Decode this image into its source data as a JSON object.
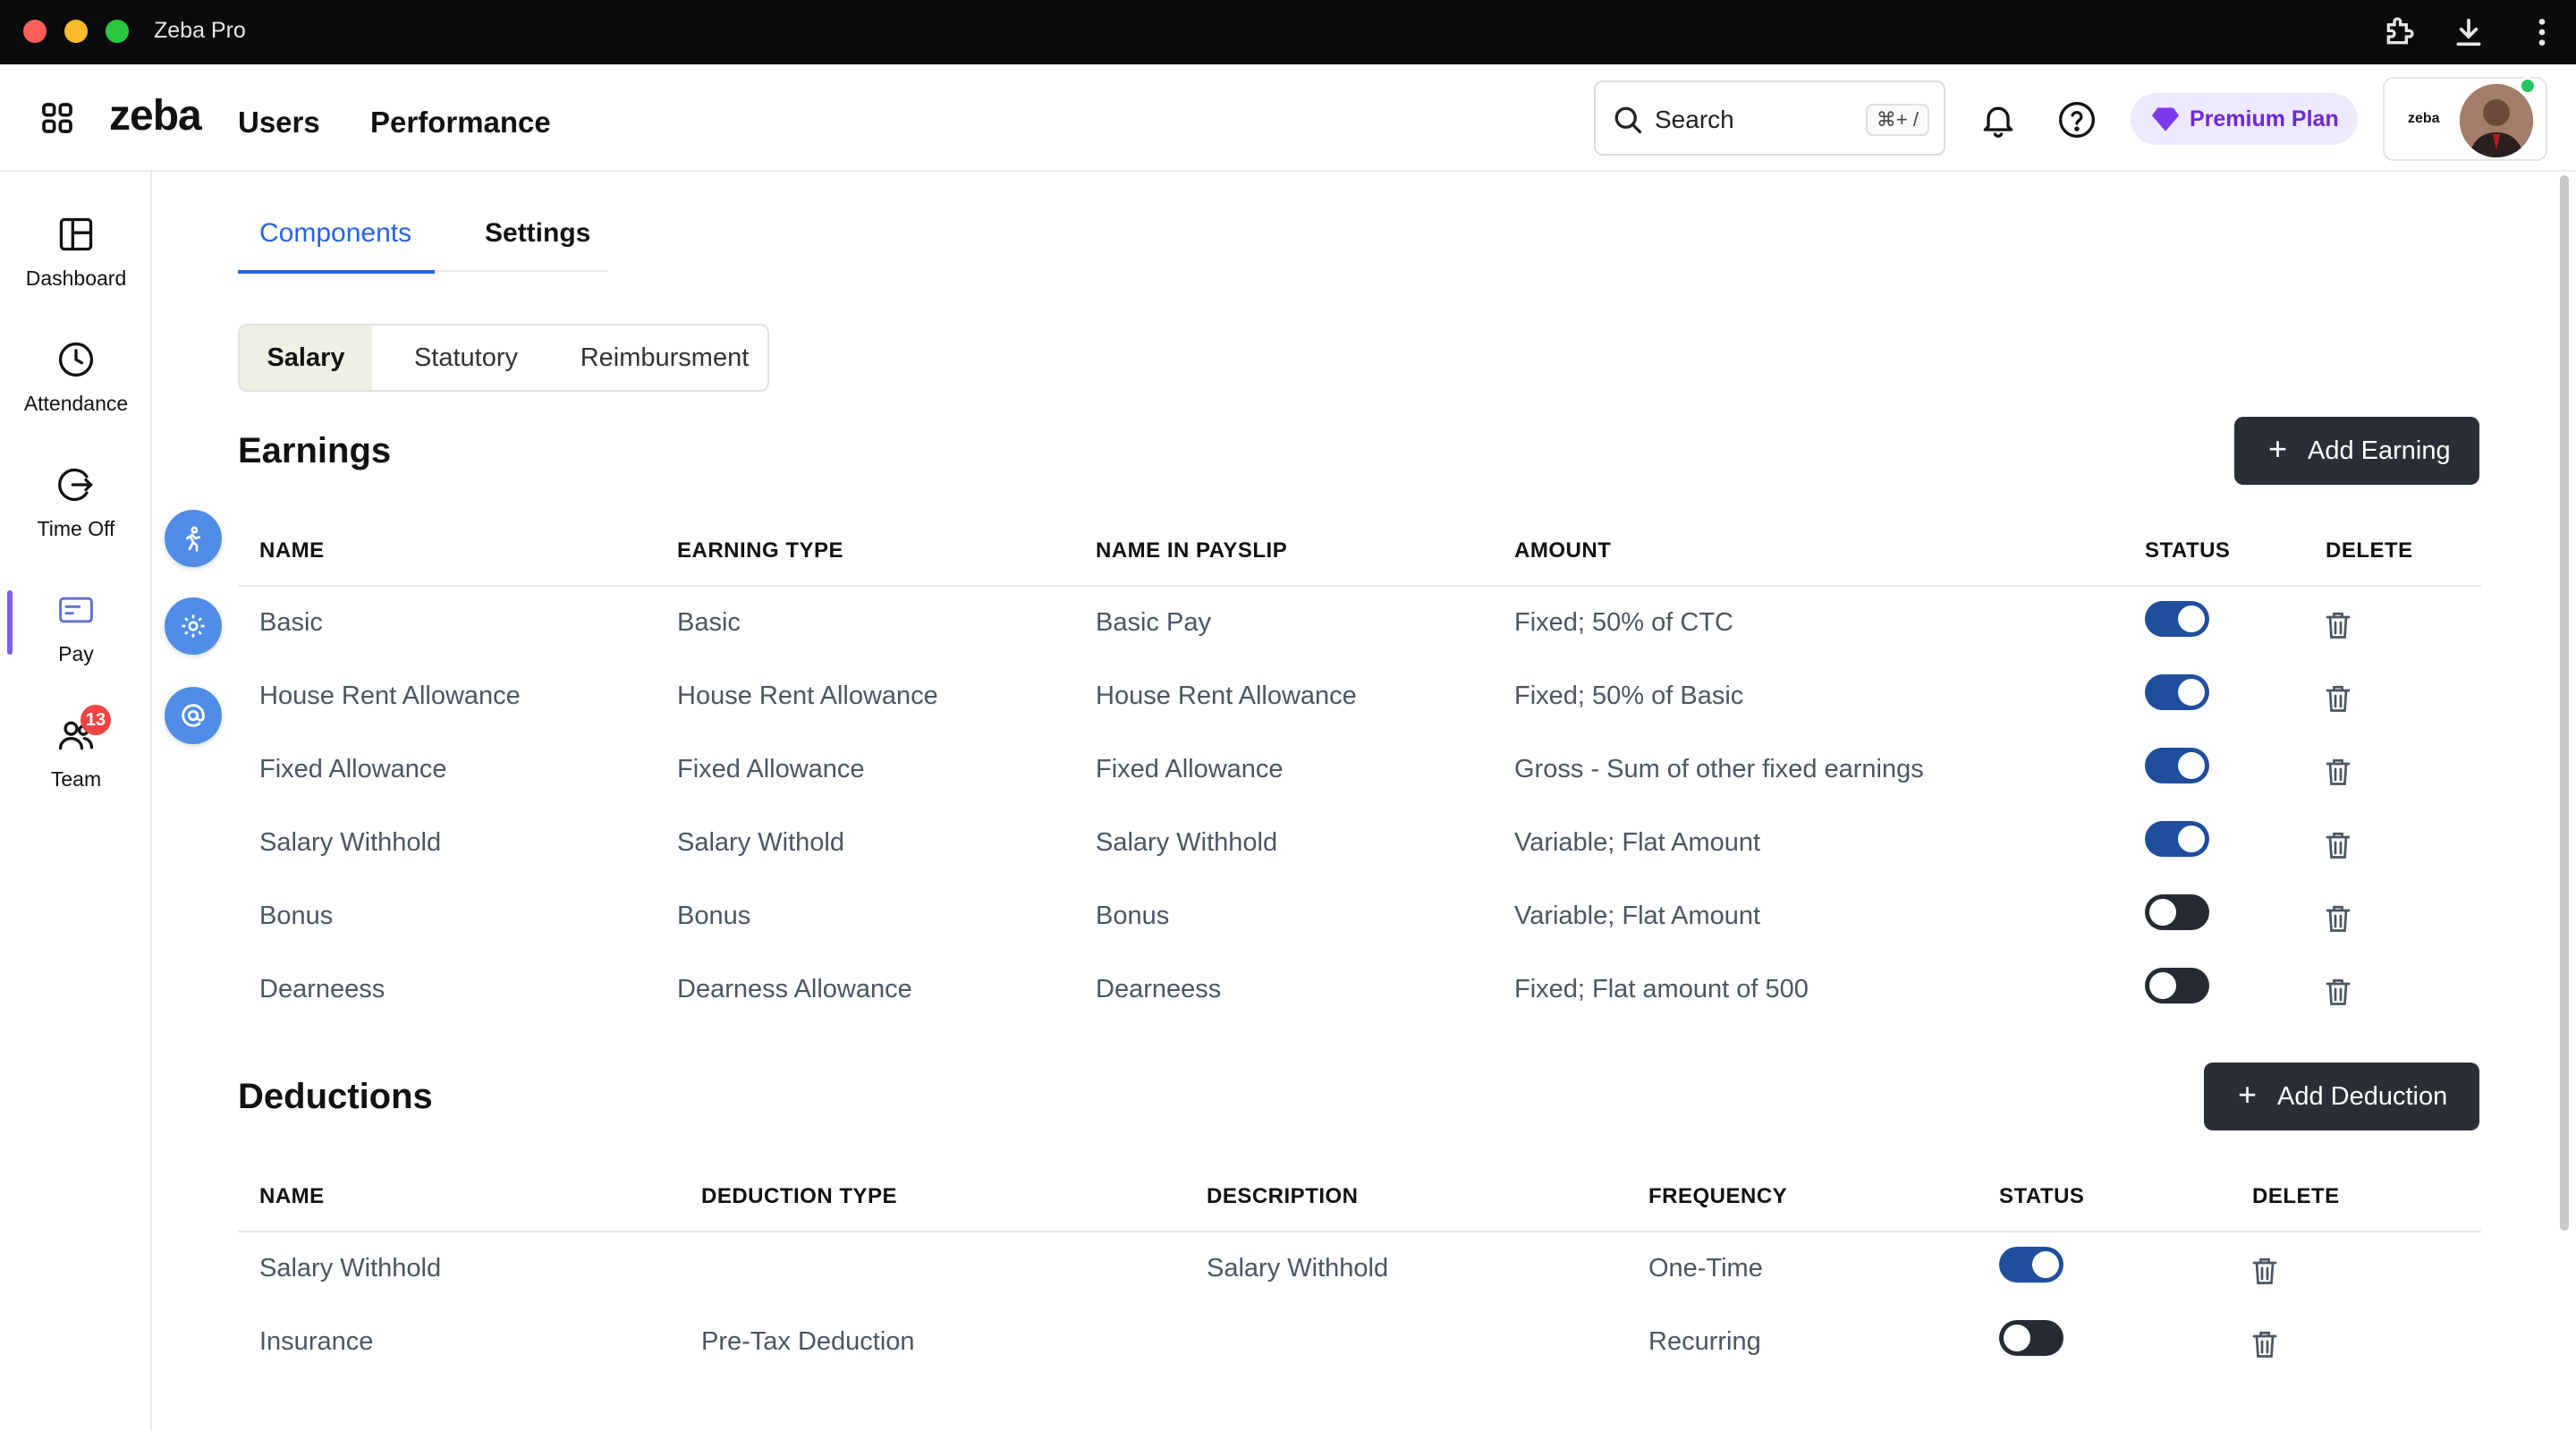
{
  "window": {
    "title": "Zeba Pro"
  },
  "header": {
    "logo": "zeba",
    "nav": [
      "Users",
      "Performance"
    ],
    "search": {
      "label": "Search",
      "shortcut": "⌘+ /"
    },
    "premium_label": "Premium Plan",
    "profile_logo": "zeba"
  },
  "sidebar": {
    "items": [
      {
        "label": "Dashboard",
        "icon": "dashboard-icon"
      },
      {
        "label": "Attendance",
        "icon": "clock-icon"
      },
      {
        "label": "Time Off",
        "icon": "logout-icon"
      },
      {
        "label": "Pay",
        "icon": "card-icon",
        "active": true
      },
      {
        "label": "Team",
        "icon": "team-icon",
        "badge": "13"
      }
    ]
  },
  "tabs": [
    "Components",
    "Settings"
  ],
  "segments": [
    "Salary",
    "Statutory",
    "Reimbursment"
  ],
  "earnings": {
    "title": "Earnings",
    "add_label": "Add Earning",
    "columns": [
      "NAME",
      "EARNING TYPE",
      "NAME IN PAYSLIP",
      "AMOUNT",
      "STATUS",
      "DELETE"
    ],
    "rows": [
      {
        "name": "Basic",
        "type": "Basic",
        "payslip": "Basic Pay",
        "amount": "Fixed; 50% of CTC",
        "status": true
      },
      {
        "name": "House Rent Allowance",
        "type": "House Rent Allowance",
        "payslip": "House Rent Allowance",
        "amount": "Fixed; 50% of Basic",
        "status": true
      },
      {
        "name": "Fixed Allowance",
        "type": "Fixed Allowance",
        "payslip": "Fixed Allowance",
        "amount": "Gross - Sum of other fixed earnings",
        "status": true
      },
      {
        "name": "Salary Withhold",
        "type": "Salary Withold",
        "payslip": "Salary Withhold",
        "amount": "Variable; Flat Amount",
        "status": true
      },
      {
        "name": "Bonus",
        "type": "Bonus",
        "payslip": "Bonus",
        "amount": "Variable; Flat Amount",
        "status": false
      },
      {
        "name": "Dearneess",
        "type": "Dearness Allowance",
        "payslip": "Dearneess",
        "amount": "Fixed; Flat amount of 500",
        "status": false
      }
    ]
  },
  "deductions": {
    "title": "Deductions",
    "add_label": "Add Deduction",
    "columns": [
      "NAME",
      "DEDUCTION TYPE",
      "DESCRIPTION",
      "FREQUENCY",
      "STATUS",
      "DELETE"
    ],
    "rows": [
      {
        "name": "Salary Withhold",
        "type": "",
        "description": "Salary Withhold",
        "frequency": "One-Time",
        "status": true
      },
      {
        "name": "Insurance",
        "type": "Pre-Tax Deduction",
        "description": "",
        "frequency": "Recurring",
        "status": false
      }
    ]
  },
  "colors": {
    "accent": "#2563eb",
    "toggle_on": "#1f4e9c",
    "toggle_off": "#262b33",
    "button_dark": "#2a2f37",
    "premium": "#6d28d9",
    "badge": "#ef4444"
  }
}
